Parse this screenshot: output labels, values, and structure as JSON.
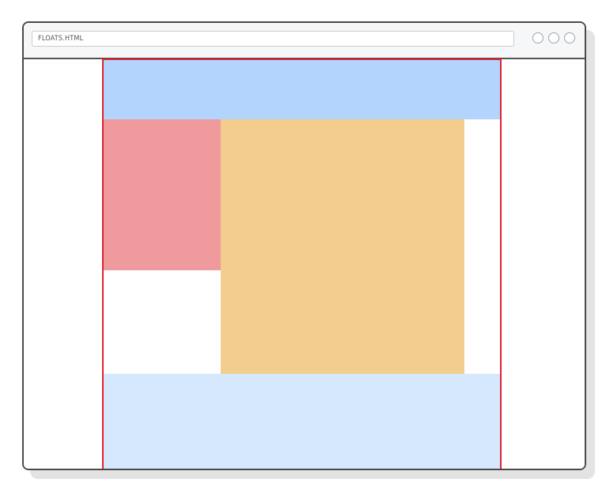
{
  "browser": {
    "address": "FLOATS.HTML",
    "window_controls": [
      "circle",
      "circle",
      "circle"
    ]
  },
  "colors": {
    "frame": "#4a4a4a",
    "container_border": "#e0212f",
    "header_block": "#b2d4fd",
    "left_float_block": "#ef9b9d",
    "main_float_block": "#f3cd8d",
    "footer_block": "#d6e8fd"
  }
}
